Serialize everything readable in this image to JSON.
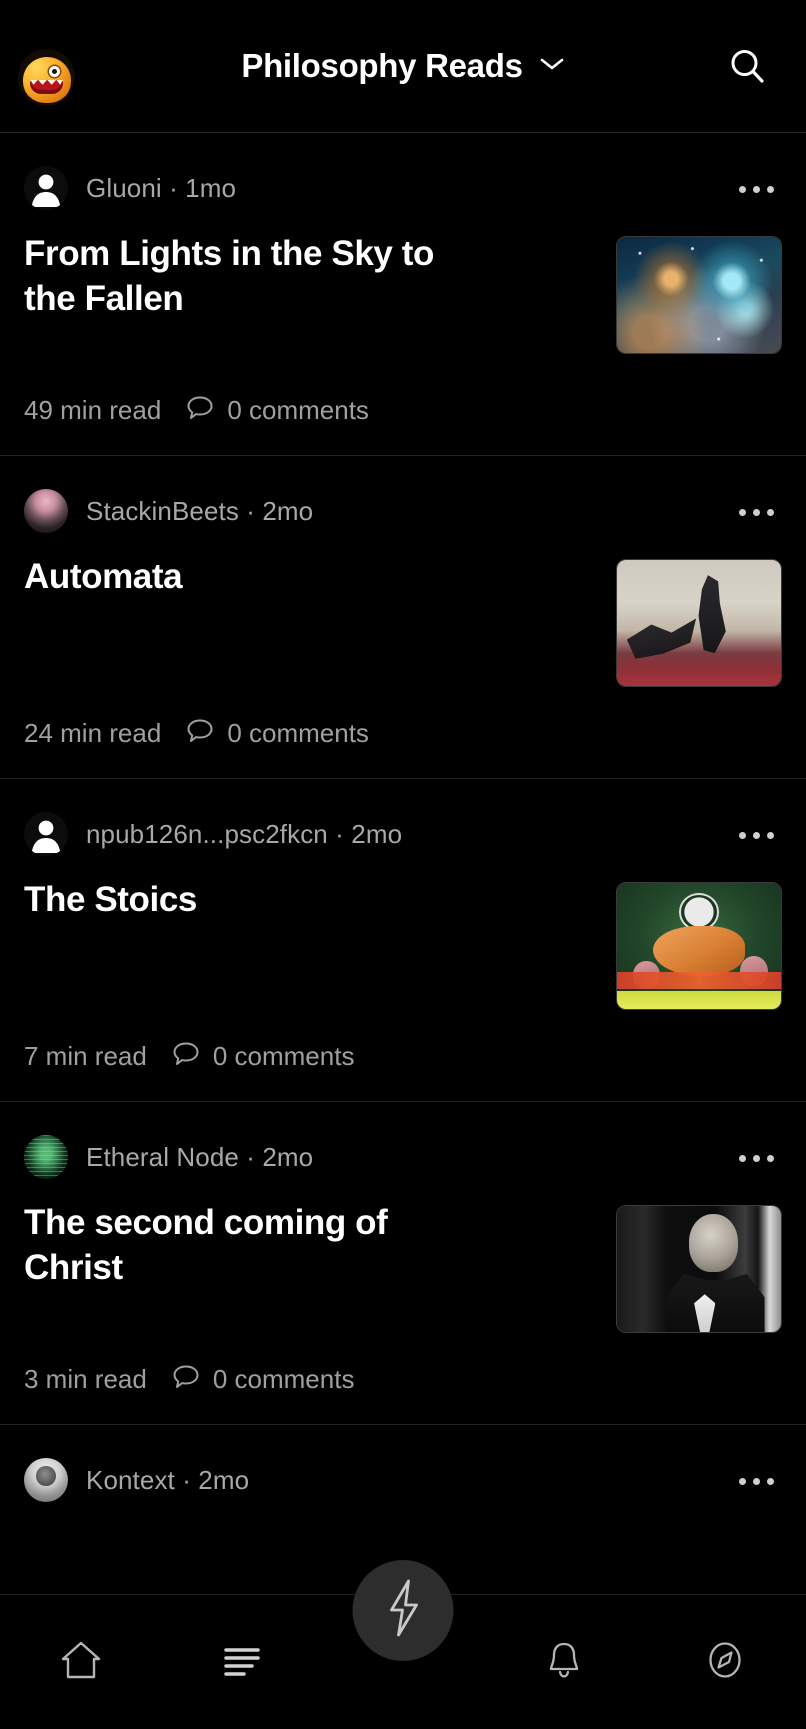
{
  "header": {
    "avatar_icon": "monster-avatar",
    "title": "Philosophy Reads",
    "dropdown_icon": "chevron-down-icon",
    "search_icon": "search-icon"
  },
  "feed": {
    "posts": [
      {
        "author": "Gluoni",
        "age": "1mo",
        "byline": "Gluoni · 1mo",
        "title": "From Lights in the Sky to the Fallen",
        "read_time": "49 min read",
        "comments": "0 comments",
        "avatar_type": "default-person-icon",
        "thumbnail": "galaxy-nebula-image",
        "more_icon": "more-options-icon"
      },
      {
        "author": "StackinBeets",
        "age": "2mo",
        "byline": "StackinBeets · 2mo",
        "title": "Automata",
        "read_time": "24 min read",
        "comments": "0 comments",
        "avatar_type": "stackinbeets-avatar",
        "thumbnail": "anime-figure-image",
        "more_icon": "more-options-icon"
      },
      {
        "author": "npub126n...psc2fkcn",
        "age": "2mo",
        "byline": "npub126n...psc2fkcn · 2mo",
        "title": "The Stoics",
        "read_time": "7 min read",
        "comments": "0 comments",
        "avatar_type": "default-person-icon",
        "thumbnail": "stoics-cartoon-image",
        "more_icon": "more-options-icon"
      },
      {
        "author": "Etheral Node",
        "age": "2mo",
        "byline": "Etheral Node · 2mo",
        "title": "The second coming of Christ",
        "read_time": "3 min read",
        "comments": "0 comments",
        "avatar_type": "etheral-node-avatar",
        "thumbnail": "portrait-photo-image",
        "more_icon": "more-options-icon"
      },
      {
        "author": "Kontext",
        "age": "2mo",
        "byline": "Kontext · 2mo",
        "avatar_type": "kontext-avatar",
        "more_icon": "more-options-icon"
      }
    ]
  },
  "navbar": {
    "items": [
      {
        "icon": "home-icon",
        "name": "home"
      },
      {
        "icon": "list-icon",
        "name": "articles"
      },
      {
        "icon": "bell-icon",
        "name": "notifications"
      },
      {
        "icon": "compass-icon",
        "name": "explore"
      }
    ],
    "fab": {
      "icon": "lightning-bolt-icon",
      "name": "zap"
    }
  },
  "colors": {
    "background": "#000000",
    "text_primary": "#ffffff",
    "text_secondary": "#a0a0a0",
    "divider": "#222222",
    "fab_background": "#2d2d2d"
  }
}
